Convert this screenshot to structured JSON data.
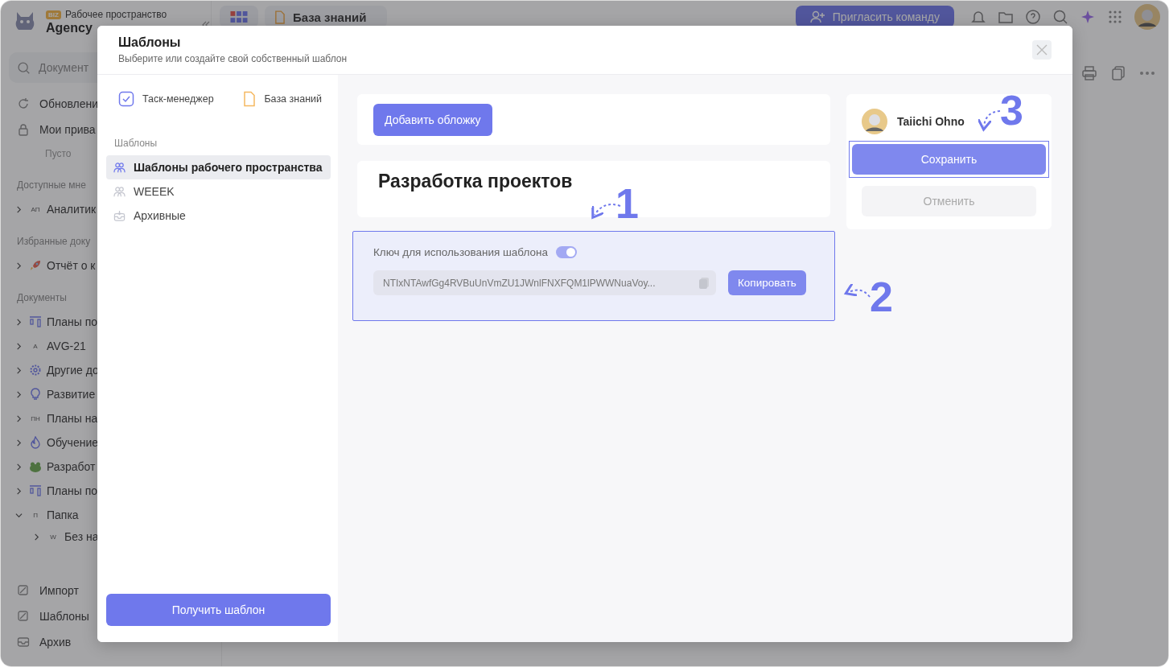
{
  "workspace": {
    "badge": "BIZ",
    "label": "Рабочее пространство",
    "name": "Agency"
  },
  "top_bar": {
    "tab": "База знаний",
    "invite_button": "Пригласить команду"
  },
  "search": {
    "placeholder": "Документ"
  },
  "sidebar": {
    "top_items": [
      {
        "label": "Обновлени"
      },
      {
        "label": "Мои прива"
      }
    ],
    "empty_note": "Пусто",
    "sections": [
      {
        "title": "Доступные мне",
        "items": [
          {
            "label": "Аналитик",
            "badge": "АП",
            "expanded": false
          }
        ]
      },
      {
        "title": "Избранные доку",
        "items": [
          {
            "label": "Отчёт о к",
            "expanded": false
          }
        ]
      },
      {
        "title": "Документы",
        "items": [
          {
            "label": "Планы по",
            "expanded": false
          },
          {
            "label": "AVG-21",
            "badge": "A",
            "expanded": false
          },
          {
            "label": "Другие до",
            "expanded": false
          },
          {
            "label": "Развитие",
            "expanded": false
          },
          {
            "label": "Планы на",
            "badge": "ПН",
            "expanded": false
          },
          {
            "label": "Обучение",
            "expanded": false
          },
          {
            "label": "Разработ",
            "expanded": false
          },
          {
            "label": "Планы по",
            "expanded": false
          },
          {
            "label": "Папка",
            "badge": "П",
            "expanded": true,
            "children": [
              {
                "label": "Без на",
                "badge": "W",
                "expanded": false
              }
            ]
          }
        ]
      }
    ],
    "bottom_items": [
      {
        "label": "Импорт"
      },
      {
        "label": "Шаблоны"
      },
      {
        "label": "Архив"
      }
    ]
  },
  "modal": {
    "title": "Шаблоны",
    "subtitle": "Выберите или создайте свой собственный шаблон",
    "apps": [
      {
        "label": "Таск-менеджер"
      },
      {
        "label": "База знаний"
      }
    ],
    "section_label": "Шаблоны",
    "categories": [
      {
        "label": "Шаблоны рабочего пространства",
        "selected": true
      },
      {
        "label": "WEEEK",
        "selected": false
      },
      {
        "label": "Архивные",
        "selected": false
      }
    ],
    "get_button": "Получить шаблон",
    "cover_button": "Добавить обложку",
    "doc_title": "Разработка проектов",
    "key": {
      "label": "Ключ для использования шаблона",
      "enabled": true,
      "value": "NTIxNTAwfGg4RVBuUnVmZU1JWnlFNXFQM1lPWWNuaVoy...",
      "copy_button": "Копировать"
    },
    "author": "Taiichi Ohno",
    "save_button": "Сохранить",
    "cancel_button": "Отменить"
  },
  "callouts": [
    "1",
    "2",
    "3"
  ]
}
